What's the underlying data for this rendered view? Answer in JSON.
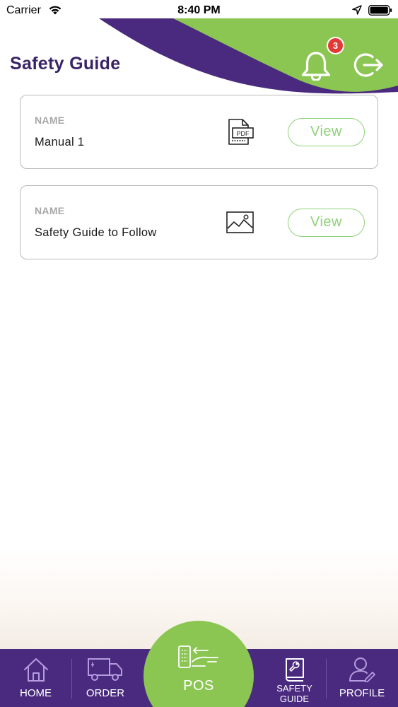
{
  "status_bar": {
    "carrier": "Carrier",
    "time": "8:40 PM",
    "icons": [
      "wifi-icon",
      "location-arrow-icon",
      "battery-icon"
    ]
  },
  "header": {
    "title": "Safety Guide",
    "notification_count": "3",
    "icons": [
      "bell-icon",
      "logout-icon"
    ]
  },
  "documents": [
    {
      "label": "NAME",
      "name": "Manual 1",
      "file_icon": "pdf-file-icon",
      "action": "View"
    },
    {
      "label": "NAME",
      "name": "Safety Guide to Follow",
      "file_icon": "image-file-icon",
      "action": "View"
    }
  ],
  "tab_bar": {
    "home": "HOME",
    "order": "ORDER",
    "pos": "POS",
    "safety_line1": "SAFETY",
    "safety_line2": "GUIDE",
    "profile": "PROFILE"
  },
  "colors": {
    "brand_purple": "#4a2a7e",
    "brand_green": "#8cc652",
    "title_purple": "#3a2468",
    "view_green": "#8fd17a",
    "badge_red": "#e53935"
  }
}
